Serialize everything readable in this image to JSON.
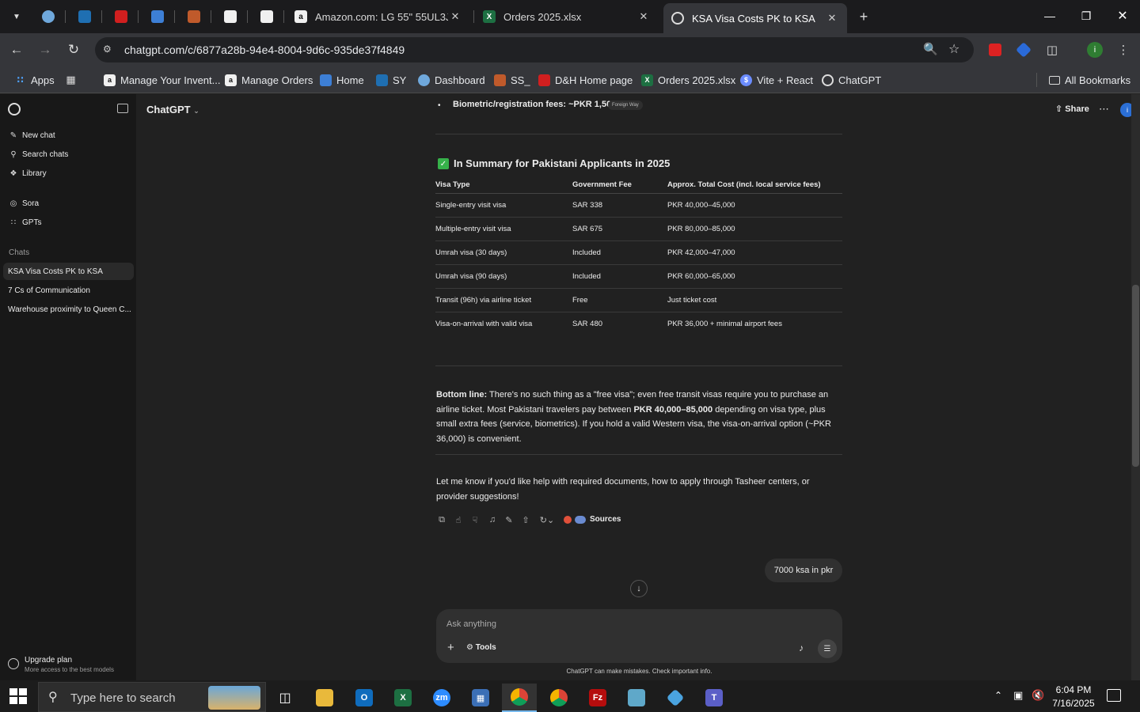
{
  "browser": {
    "tabs": [
      {
        "label": "Amazon.com: LG 55\" 55UL3J-E",
        "favicon": "a"
      },
      {
        "label": "Orders 2025.xlsx",
        "favicon": "X"
      },
      {
        "label": "KSA Visa Costs PK to KSA",
        "favicon": "gpt"
      }
    ],
    "url": "chatgpt.com/c/6877a28b-94e4-8004-9d6c-935de37f4849",
    "bookmarks": [
      {
        "label": "Apps"
      },
      {
        "label": "Manage Your Invent..."
      },
      {
        "label": "Manage Orders"
      },
      {
        "label": "Home"
      },
      {
        "label": "SY"
      },
      {
        "label": "Dashboard"
      },
      {
        "label": "SS_"
      },
      {
        "label": "D&H Home page"
      },
      {
        "label": "Orders 2025.xlsx"
      },
      {
        "label": "Vite + React"
      },
      {
        "label": "ChatGPT"
      }
    ],
    "all_bookmarks": "All Bookmarks"
  },
  "sidebar": {
    "nav": [
      {
        "label": "New chat",
        "icon": "pencil-icon"
      },
      {
        "label": "Search chats",
        "icon": "search-icon"
      },
      {
        "label": "Library",
        "icon": "library-icon"
      },
      {
        "label": "Sora",
        "icon": "sora-icon"
      },
      {
        "label": "GPTs",
        "icon": "grid-icon"
      }
    ],
    "chats_heading": "Chats",
    "chats": [
      {
        "label": "KSA Visa Costs PK to KSA"
      },
      {
        "label": "7 Cs of Communication"
      },
      {
        "label": "Warehouse proximity to Queen C..."
      }
    ],
    "upgrade": {
      "title": "Upgrade plan",
      "subtitle": "More access to the best models"
    }
  },
  "header": {
    "model": "ChatGPT",
    "share": "Share"
  },
  "content": {
    "biometric_line": "Biometric/registration fees: ~PKR 1,500",
    "biometric_source": "Foreign Way",
    "summary_heading": "In Summary for Pakistani Applicants in 2025",
    "table": {
      "headers": [
        "Visa Type",
        "Government Fee",
        "Approx. Total Cost (incl. local service fees)"
      ],
      "rows": [
        [
          "Single-entry visit visa",
          "SAR 338",
          "PKR 40,000–45,000"
        ],
        [
          "Multiple-entry visit visa",
          "SAR 675",
          "PKR 80,000–85,000"
        ],
        [
          "Umrah visa (30 days)",
          "Included",
          "PKR 42,000–47,000"
        ],
        [
          "Umrah visa (90 days)",
          "Included",
          "PKR 60,000–65,000"
        ],
        [
          "Transit (96h) via airline ticket",
          "Free",
          "Just ticket cost"
        ],
        [
          "Visa-on-arrival with valid visa",
          "SAR 480",
          "PKR 36,000 + minimal airport fees"
        ]
      ]
    },
    "bottom_line_label": "Bottom line:",
    "bottom_line_a": " There's no such thing as a \"free visa\"; even free transit visas require you to purchase an airline ticket. Most Pakistani travelers pay between ",
    "bottom_line_bold": "PKR 40,000–85,000",
    "bottom_line_b": " depending on visa type, plus small extra fees (service, biometrics). If you hold a valid Western visa, the visa-on-arrival option (~PKR 36,000) is convenient.",
    "followup": "Let me know if you'd like help with required documents, how to apply through Tasheer centers, or provider suggestions!",
    "sources_label": "Sources",
    "user_message": "7000 ksa in pkr"
  },
  "composer": {
    "placeholder": "Ask anything",
    "tools": "Tools"
  },
  "disclaimer": "ChatGPT can make mistakes. Check important info.",
  "taskbar": {
    "search_placeholder": "Type here to search",
    "time": "6:04 PM",
    "date": "7/16/2025"
  }
}
